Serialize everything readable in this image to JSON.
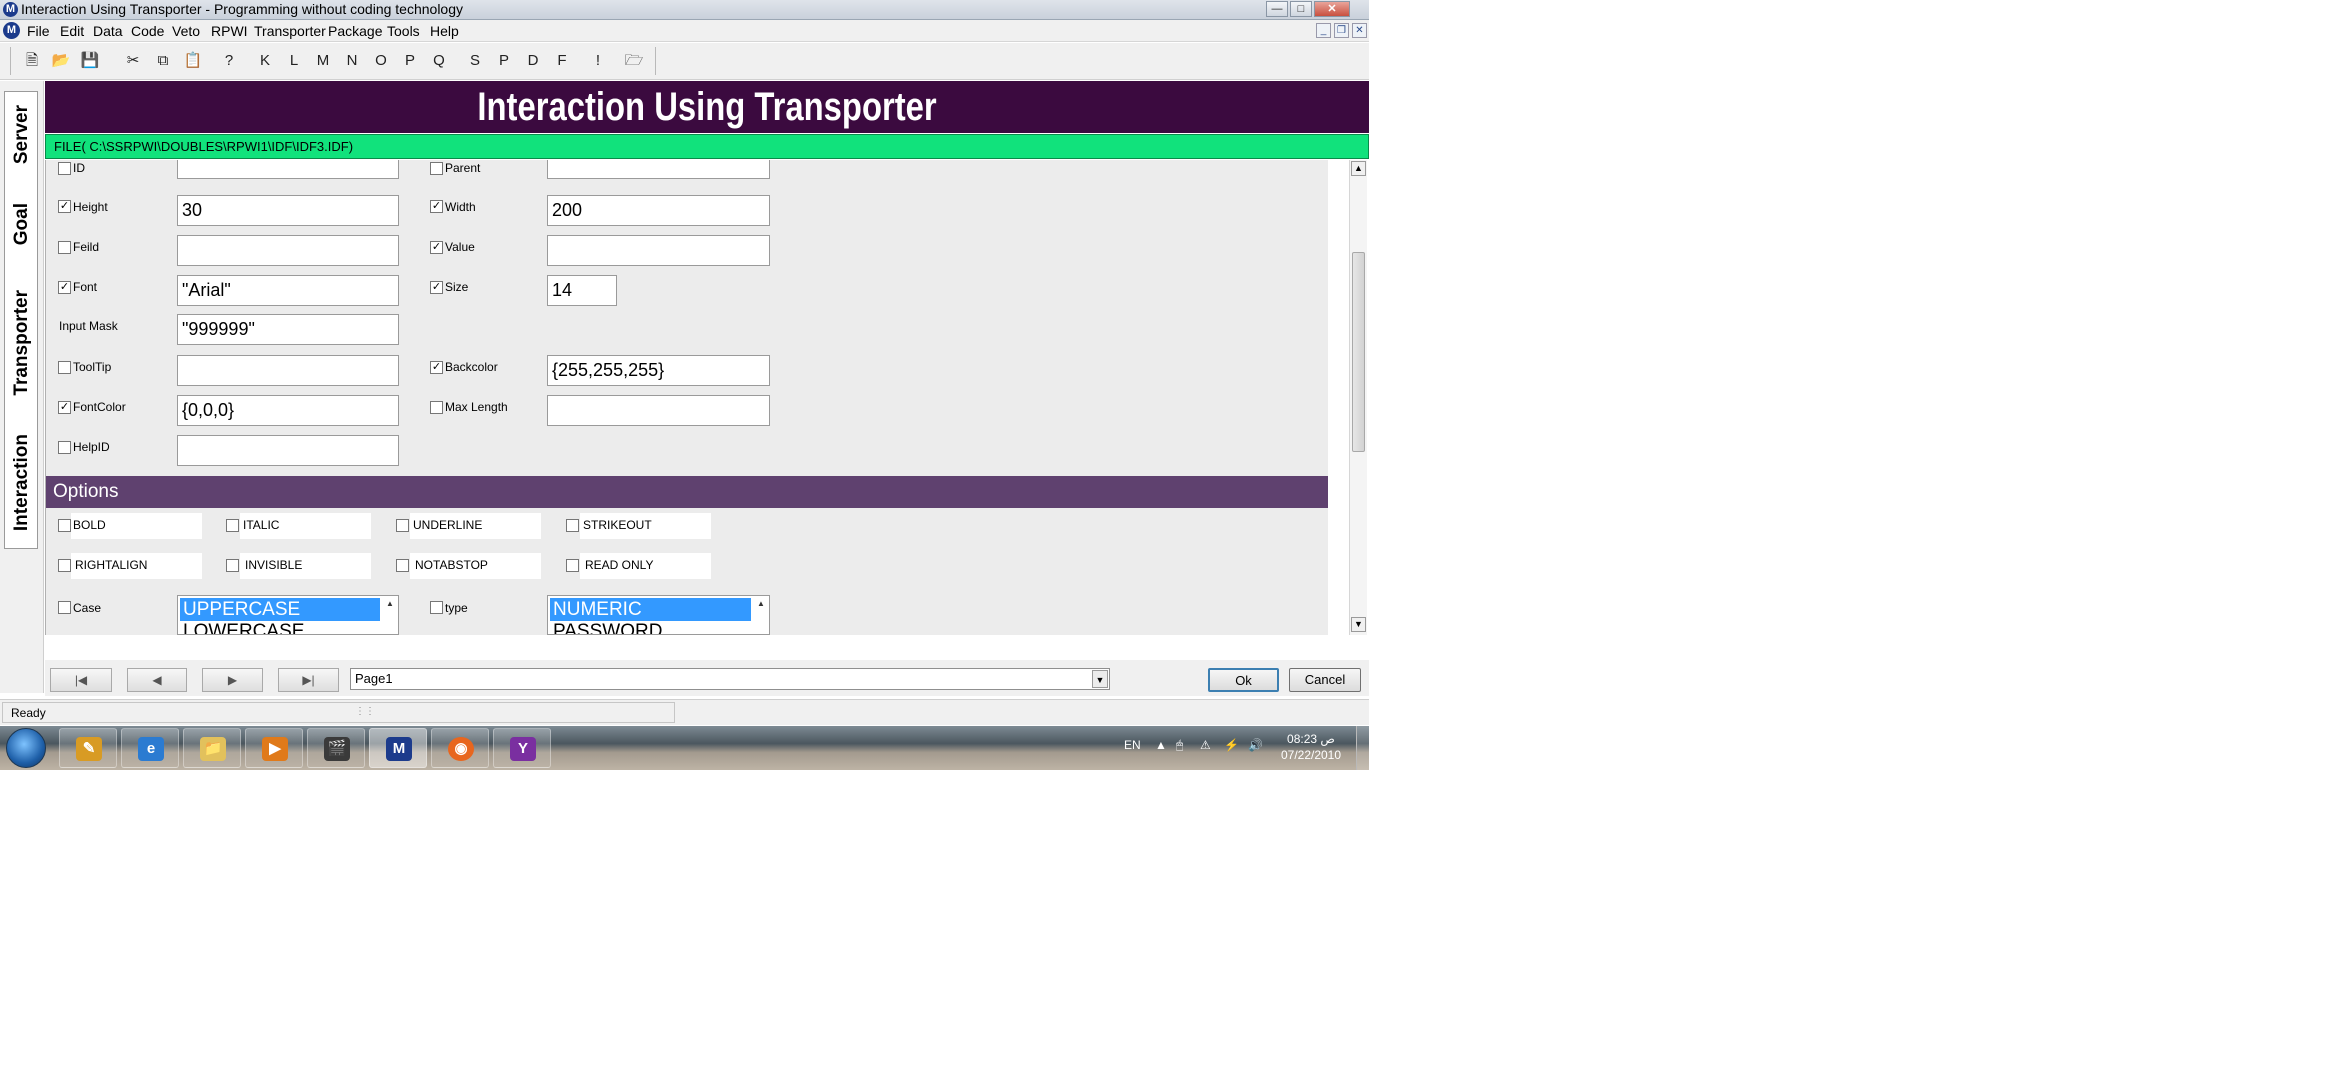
{
  "window": {
    "title": "Interaction Using Transporter - Programming without coding technology"
  },
  "menu": [
    "File",
    "Edit",
    "Data",
    "Code",
    "Veto",
    "RPWI",
    "Transporter",
    "Package",
    "Tools",
    "Help"
  ],
  "toolbar": {
    "letters": [
      "K",
      "L",
      "M",
      "N",
      "O",
      "P",
      "Q",
      "S",
      "P",
      "D",
      "F",
      "!"
    ]
  },
  "side_tabs": [
    "Server",
    "Goal",
    "Transporter",
    "Interaction"
  ],
  "banner": {
    "title": "Interaction Using Transporter"
  },
  "file_path": "FILE( C:\\SSRPWI\\DOUBLES\\RPWI1\\IDF\\IDF3.IDF)",
  "fields": {
    "id": {
      "label": "ID",
      "checked": false,
      "value": ""
    },
    "parent": {
      "label": "Parent",
      "checked": false,
      "value": ""
    },
    "height": {
      "label": "Height",
      "checked": true,
      "value": "30"
    },
    "width": {
      "label": "Width",
      "checked": true,
      "value": "200"
    },
    "feild": {
      "label": "Feild",
      "checked": false,
      "value": ""
    },
    "value": {
      "label": "Value",
      "checked": true,
      "value": ""
    },
    "font": {
      "label": "Font",
      "checked": true,
      "value": "\"Arial\""
    },
    "size": {
      "label": "Size",
      "checked": true,
      "value": "14"
    },
    "input_mask": {
      "label": "Input Mask",
      "value": "\"999999\""
    },
    "tooltip": {
      "label": "ToolTip",
      "checked": false,
      "value": ""
    },
    "backcolor": {
      "label": "Backcolor",
      "checked": true,
      "value": "{255,255,255}"
    },
    "fontcolor": {
      "label": "FontColor",
      "checked": true,
      "value": "{0,0,0}"
    },
    "maxlength": {
      "label": "Max Length",
      "checked": false,
      "value": ""
    },
    "helpid": {
      "label": "HelpID",
      "checked": false,
      "value": ""
    }
  },
  "options": {
    "header": "Options",
    "bold": "BOLD",
    "italic": "ITALIC",
    "underline": "UNDERLINE",
    "strikeout": "STRIKEOUT",
    "rightalign": "RIGHTALIGN",
    "invisible": "INVISIBLE",
    "notabstop": "NOTABSTOP",
    "readonly": "READ ONLY",
    "case": {
      "label": "Case",
      "selected": "UPPERCASE",
      "next": "LOWERCASE"
    },
    "type": {
      "label": "type",
      "selected": "NUMERIC",
      "next": "PASSWORD"
    }
  },
  "nav": {
    "page": "Page1",
    "ok": "Ok",
    "cancel": "Cancel"
  },
  "status": {
    "text": "Ready"
  },
  "taskbar": {
    "lang": "EN",
    "time": "08:23 ص",
    "date": "07/22/2010"
  },
  "colors": {
    "banner_bg": "#3b0a3f",
    "file_bar_bg": "#11e27c",
    "options_header_bg": "#5f416f",
    "selection": "#3399ff"
  }
}
